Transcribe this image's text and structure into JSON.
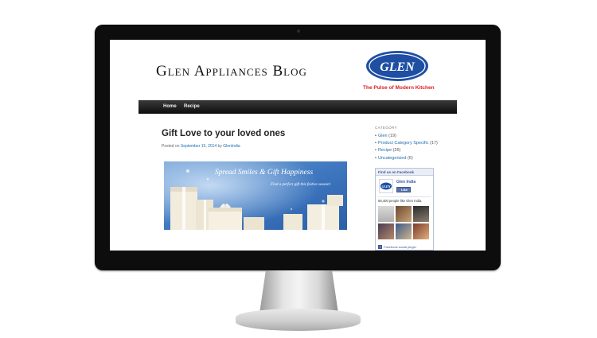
{
  "blog": {
    "title": "Glen Appliances Blog",
    "logo_text": "GLEN",
    "tagline": "The Pulse of Modern Kitchen"
  },
  "nav": {
    "items": [
      {
        "label": "Home"
      },
      {
        "label": "Recipe"
      }
    ]
  },
  "post": {
    "title": "Gift Love to your loved ones",
    "meta_prefix": "Posted on",
    "date": "September 15, 2014",
    "meta_by": "by",
    "author": "GlenIndia",
    "banner_headline": "Spread Smiles & Gift Happiness",
    "banner_subtext": "Find a perfect gift this festive season!"
  },
  "sidebar": {
    "category_heading": "CATEGORY",
    "categories": [
      {
        "name": "Glen",
        "count": "(19)"
      },
      {
        "name": "Product Category Specific",
        "count": "(17)"
      },
      {
        "name": "Recipe",
        "count": "(26)"
      },
      {
        "name": "Uncategorized",
        "count": "(6)"
      }
    ],
    "facebook": {
      "header": "Find us on Facebook",
      "page_name": "Glen India",
      "logo_text": "GLEN",
      "like_label": "Like",
      "likes_text": "58,400 people like Glen India.",
      "footer": "Facebook social plugin"
    }
  },
  "colors": {
    "brand_blue": "#1e4fa3",
    "brand_red": "#d81e1e",
    "link_blue": "#1b6cb0",
    "nav_bg": "#111111",
    "facebook_blue": "#3b5998"
  }
}
